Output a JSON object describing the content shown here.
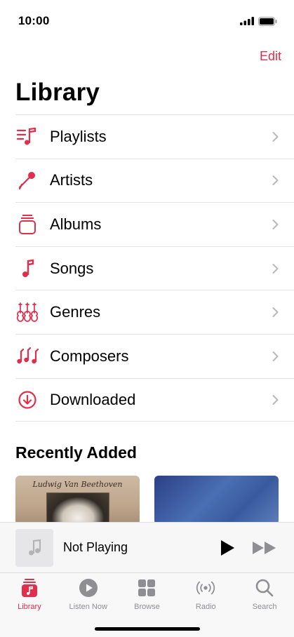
{
  "status": {
    "time": "10:00"
  },
  "header": {
    "edit_label": "Edit",
    "title": "Library"
  },
  "library_items": [
    {
      "label": "Playlists",
      "icon": "playlists-icon"
    },
    {
      "label": "Artists",
      "icon": "microphone-icon"
    },
    {
      "label": "Albums",
      "icon": "albums-icon"
    },
    {
      "label": "Songs",
      "icon": "music-note-icon"
    },
    {
      "label": "Genres",
      "icon": "guitars-icon"
    },
    {
      "label": "Composers",
      "icon": "notes-icon"
    },
    {
      "label": "Downloaded",
      "icon": "download-icon"
    }
  ],
  "recent": {
    "title": "Recently Added",
    "albums": [
      {
        "art_text": "Ludwig Van Beethoven"
      },
      {
        "art_text": ""
      }
    ]
  },
  "player": {
    "title": "Not Playing"
  },
  "tabs": [
    {
      "label": "Library",
      "active": true
    },
    {
      "label": "Listen Now",
      "active": false
    },
    {
      "label": "Browse",
      "active": false
    },
    {
      "label": "Radio",
      "active": false
    },
    {
      "label": "Search",
      "active": false
    }
  ],
  "colors": {
    "accent": "#e02e4b",
    "inactive": "#8e8e93",
    "divider": "#e4e4e6"
  }
}
